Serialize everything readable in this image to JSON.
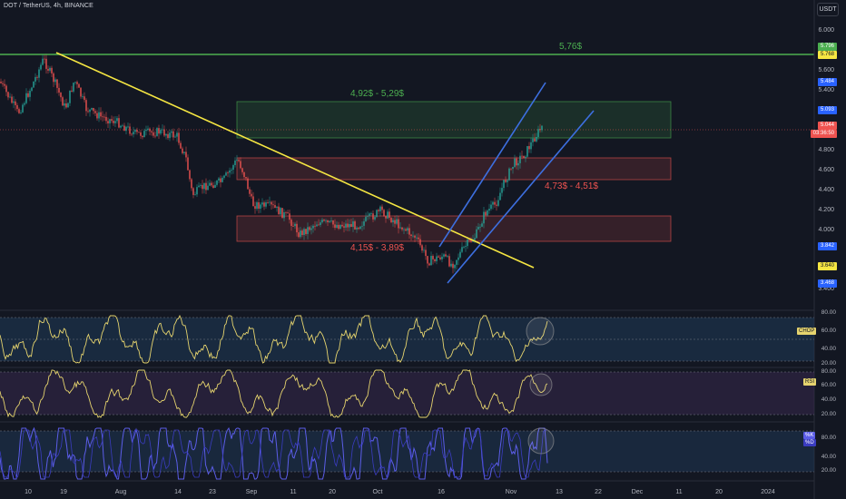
{
  "header": {
    "symbol": "DOT / TetherUS, 4h, BINANCE",
    "currency": "USDT"
  },
  "price_axis": {
    "ticks": [
      "6.000",
      "5.600",
      "5.400",
      "4.800",
      "4.600",
      "4.400",
      "4.200",
      "4.000",
      "3.400"
    ],
    "tags": {
      "resistance_top": "5.796",
      "resistance_low": "5.768",
      "blue_high": "5.484",
      "blue_mid": "5.093",
      "last_price": "5.044",
      "countdown": "03:36:50",
      "blue_low1": "3.842",
      "level": "3.640",
      "blue_low2": "3.468"
    }
  },
  "annotations": {
    "resistance": "5,76$",
    "upper_zone": "4,92$ - 5,29$",
    "middle_zone": "4,73$ - 4,51$",
    "lower_zone": "4,15$ - 3,89$"
  },
  "indicators": {
    "chop": {
      "tag": "CHOP",
      "ticks": [
        "80.00",
        "60.00",
        "40.00",
        "20.00"
      ],
      "color": "#e6d46e"
    },
    "rsi": {
      "tag": "RSI",
      "ticks": [
        "80.00",
        "60.00",
        "40.00",
        "20.00"
      ],
      "color": "#e6d46e"
    },
    "stoch": {
      "tag_k": "%K",
      "tag_d": "%D",
      "ticks": [
        "80.00",
        "40.00",
        "20.00"
      ],
      "color": "#5b5de8"
    }
  },
  "time_axis": {
    "labels": [
      "10",
      "19",
      "Aug",
      "14",
      "23",
      "Sep",
      "11",
      "20",
      "Oct",
      "16",
      "Nov",
      "13",
      "22",
      "Dec",
      "11",
      "20",
      "2024"
    ]
  },
  "colors": {
    "background": "#131722",
    "resistance_line": "#4caf50",
    "trend_line": "#f5e642",
    "channel": "#3d6fe0",
    "candle_up": "#26a69a",
    "candle_down": "#ef5350",
    "bullish_zone": "#4caf50",
    "bearish_zone": "#ef5350"
  }
}
